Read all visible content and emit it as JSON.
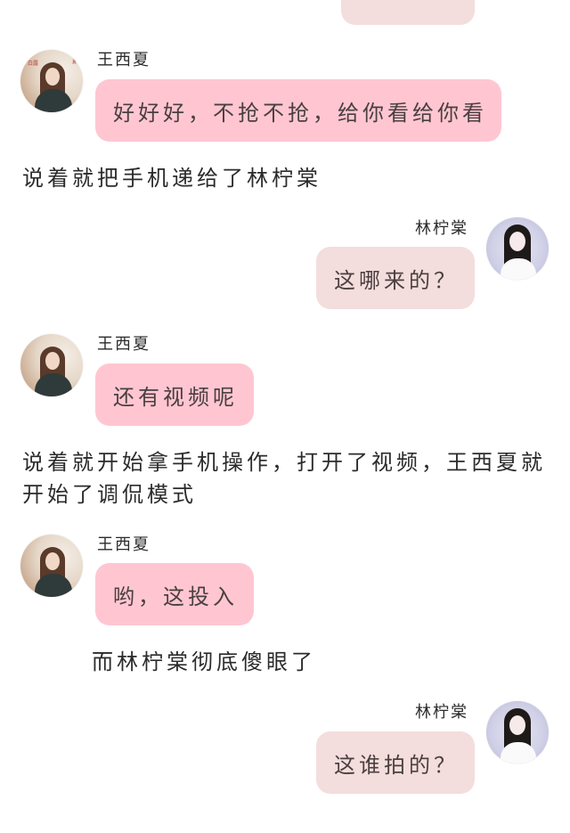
{
  "top_bubble": {
    "text": ""
  },
  "messages": [
    {
      "id": "m1",
      "speaker": "王西夏",
      "text": "好好好，不抢不抢，给你看给你看"
    },
    {
      "id": "n1",
      "narration": "说着就把手机递给了林柠棠"
    },
    {
      "id": "m2",
      "speaker": "林柠棠",
      "text": "这哪来的？"
    },
    {
      "id": "m3",
      "speaker": "王西夏",
      "text": "还有视频呢"
    },
    {
      "id": "n2",
      "narration_lines": [
        "说着就开始拿手机操作，打开了视频，王西夏就",
        "开始了调侃模式"
      ]
    },
    {
      "id": "m4",
      "speaker": "王西夏",
      "text": "哟，这投入"
    },
    {
      "id": "n3",
      "narration": "而林柠棠彻底傻眼了"
    },
    {
      "id": "m5",
      "speaker": "林柠棠",
      "text": "这谁拍的？"
    }
  ],
  "avatar_text": {
    "wang_left_small": "白露",
    "wang_right_small": "夏"
  },
  "colors": {
    "left_bubble": "#ffc6d2",
    "right_bubble": "#f4dddd",
    "text": "#2b2b2b"
  },
  "icons": {
    "wang_avatar": "woman-portrait-avatar",
    "lin_avatar": "woman-portrait-avatar"
  }
}
